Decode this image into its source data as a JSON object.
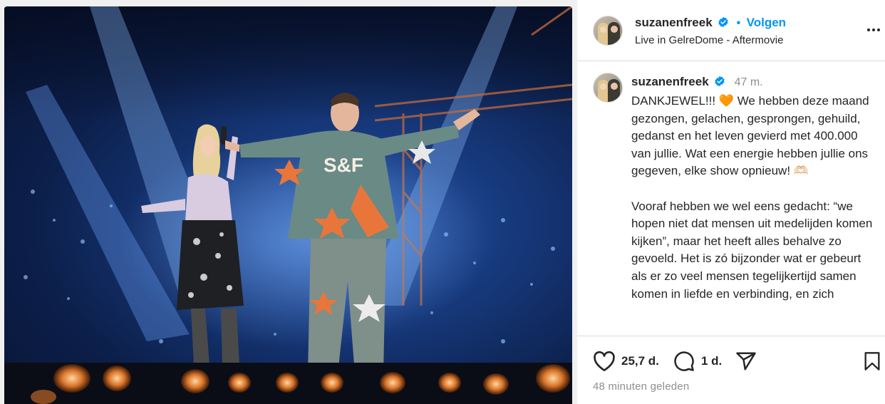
{
  "header": {
    "username": "suzanenfreek",
    "follow_separator": "•",
    "follow_label": "Volgen",
    "subtitle": "Live in GelreDome - Aftermovie",
    "more_icon": "more-horizontal-icon"
  },
  "caption": {
    "username": "suzanenfreek",
    "time_ago": "47 m.",
    "text": "DANKJEWEL!!! 🧡 We hebben deze maand gezongen, gelachen, gesprongen, gehuild, gedanst en het leven gevierd met 400.000 van jullie. Wat een energie hebben jullie ons gegeven, elke show opnieuw! 🫶🏻\n\nVooraf hebben we wel eens gedacht: “we hopen niet dat mensen uit medelijden komen kijken”, maar het heeft alles behalve zo gevoeld. Het is zó bijzonder wat er gebeurt als er zo veel mensen tegelijkertijd samen komen in liefde en verbinding, en zich"
  },
  "actions": {
    "likes": "25,7 d.",
    "comments": "1 d.",
    "icons": [
      "heart-icon",
      "comment-icon",
      "share-icon",
      "bookmark-icon"
    ]
  },
  "post_time": "48 minuten geleden",
  "media": {
    "jacket_text": "S&F",
    "colors": {
      "accent": "#0095f6",
      "stage_blue": "#173a7e",
      "jacket": "#6a8a86",
      "orange": "#e8763a"
    }
  }
}
